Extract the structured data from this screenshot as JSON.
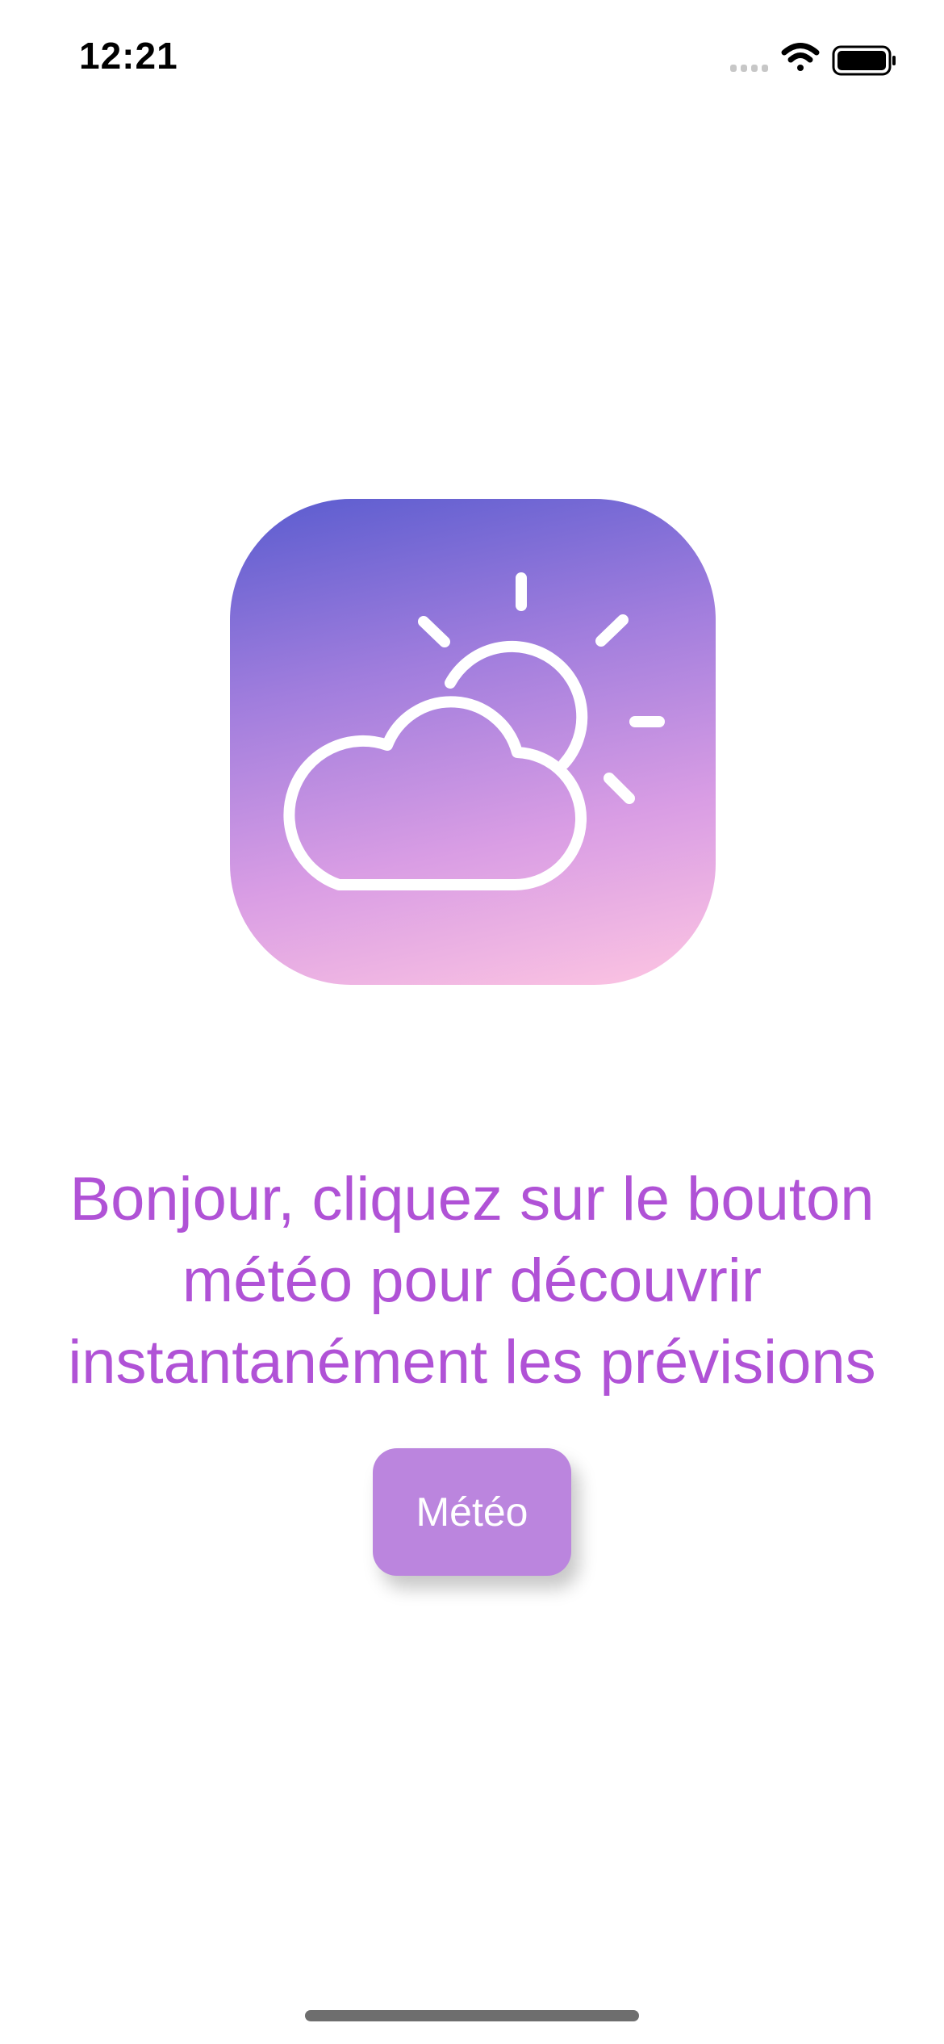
{
  "status_bar": {
    "time": "12:21",
    "icons": [
      "cellular-signal-icon",
      "wifi-icon",
      "battery-icon"
    ]
  },
  "app_icon": {
    "icon": "partly-cloudy-icon",
    "gradient": [
      "#5a5ccf",
      "#a07ddd",
      "#d99de4",
      "#fdc5e2"
    ]
  },
  "main": {
    "message_lines": [
      "Bonjour, cliquez sur le bouton",
      "météo pour découvrir",
      "instantanément les prévisions"
    ],
    "button_label": "Météo"
  },
  "colors": {
    "text_accent": "#b052d6",
    "button_bg": "#bb85de",
    "button_text": "#ffffff"
  }
}
